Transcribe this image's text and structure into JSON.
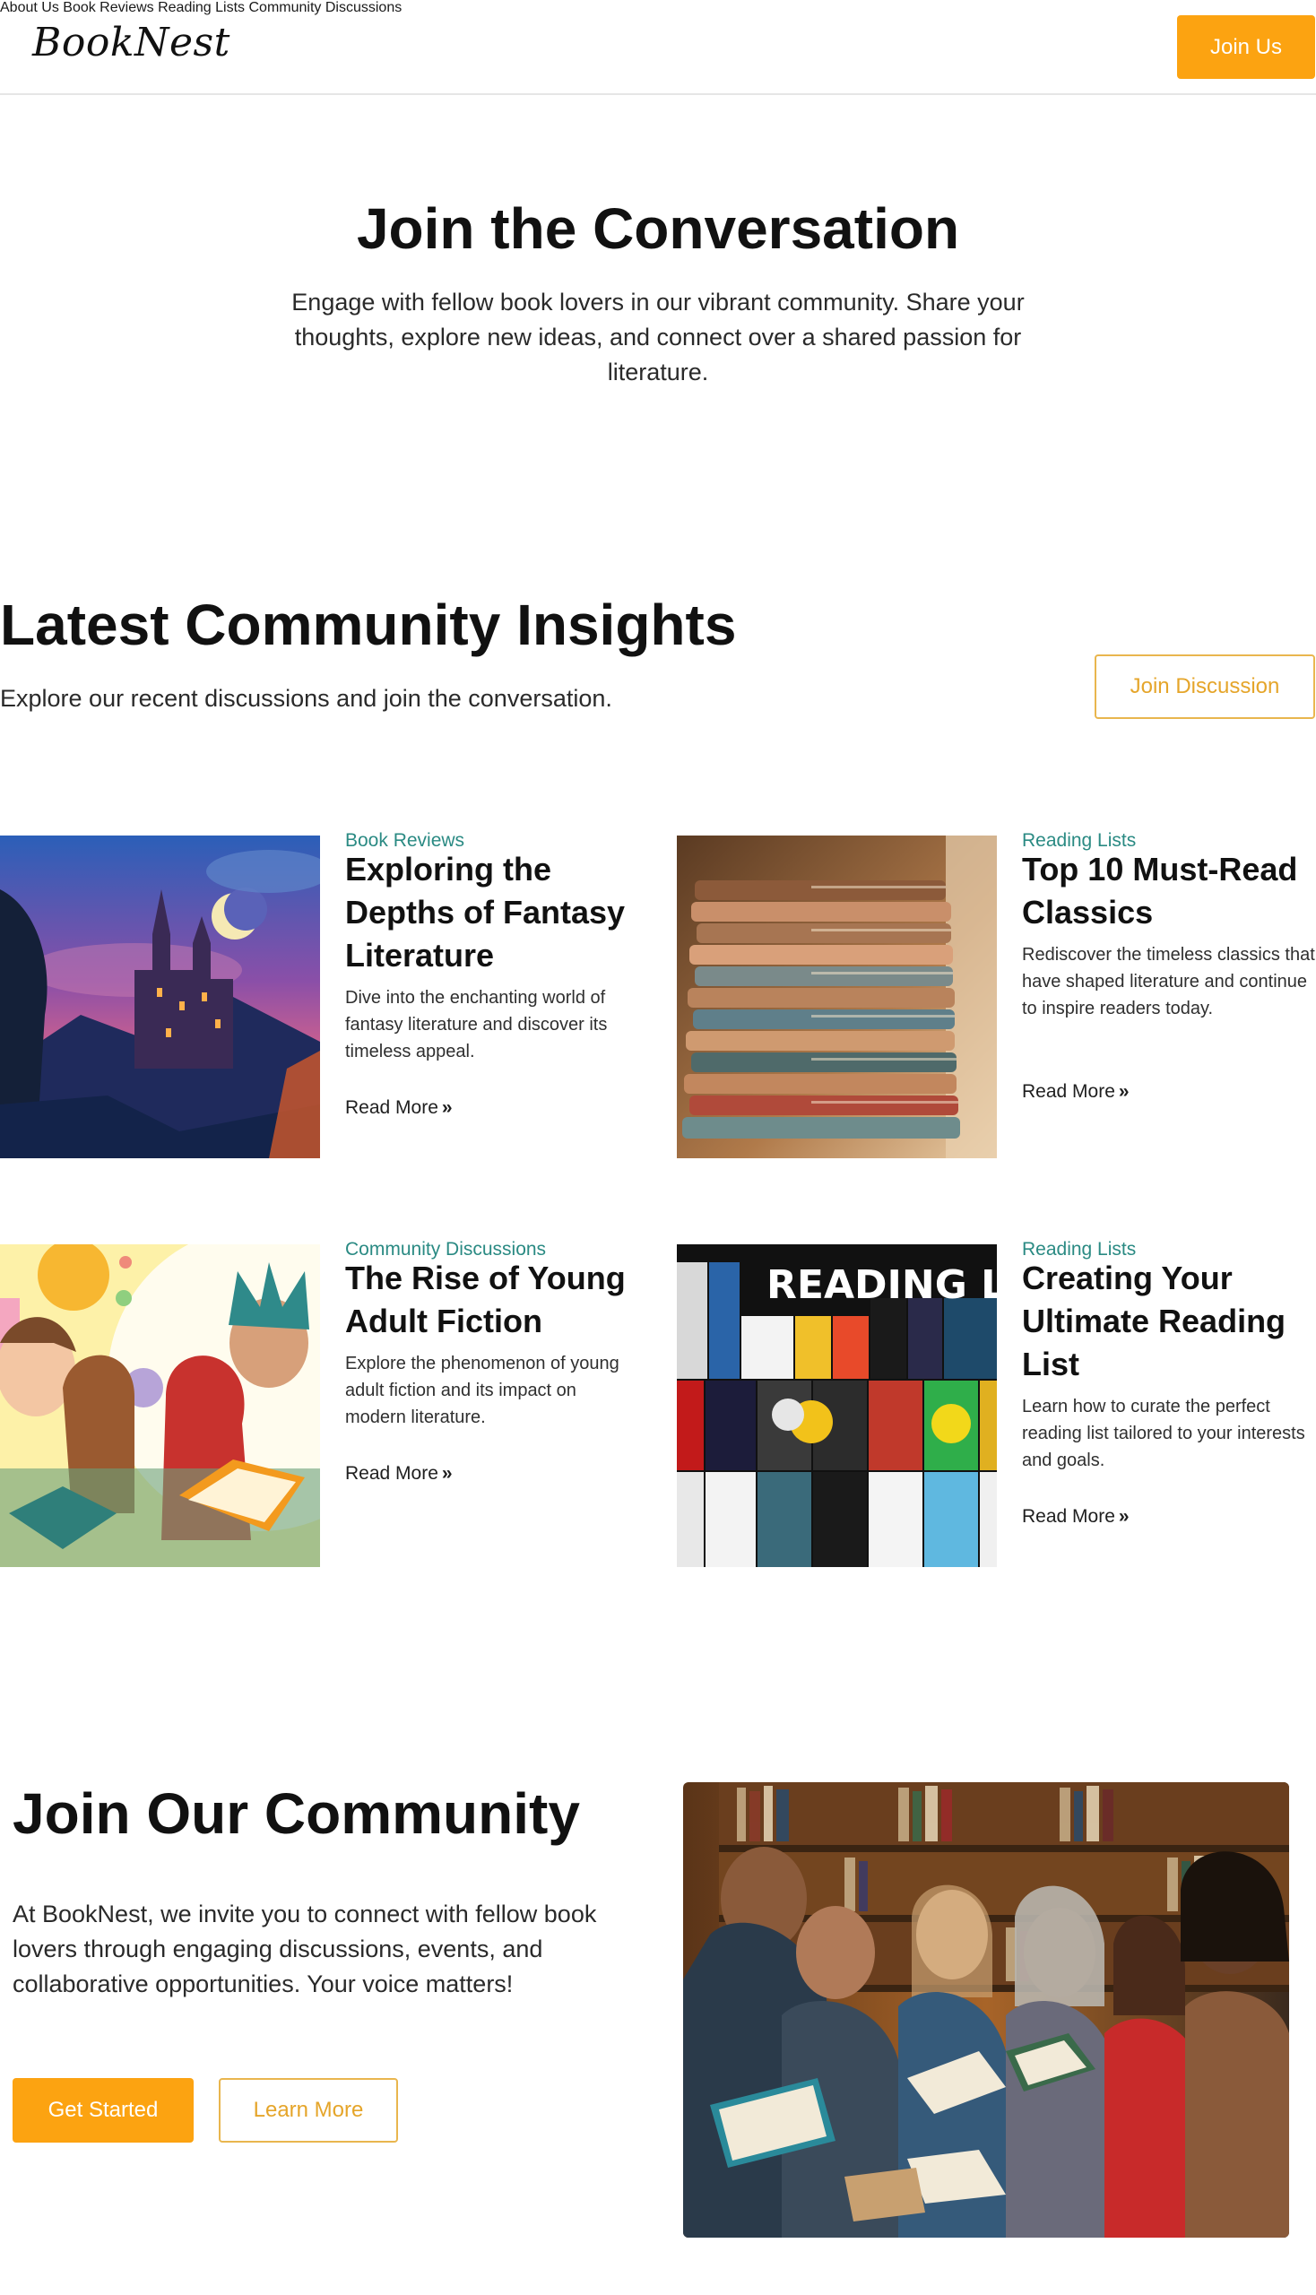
{
  "header": {
    "logo": "BookNest",
    "nav": [
      "About Us",
      "Book Reviews",
      "Reading Lists",
      "Community Discussions"
    ],
    "join_label": "Join Us"
  },
  "hero": {
    "title": "Join the Conversation",
    "description": "Engage with fellow book lovers in our vibrant community. Share your thoughts, explore new ideas, and connect over a shared passion for literature."
  },
  "insights": {
    "title": "Latest Community Insights",
    "subtitle": "Explore our recent discussions and join the conversation.",
    "button_label": "Join Discussion",
    "cards": [
      {
        "category": "Book Reviews",
        "title": "Exploring the Depths of Fantasy Literature",
        "description": "Dive into the enchanting world of fantasy literature and discover its timeless appeal.",
        "link": "Read More",
        "image_icon": "fantasy-castle-image"
      },
      {
        "category": "Reading Lists",
        "title": "Top 10 Must-Read Classics",
        "description": "Rediscover the timeless classics that have shaped literature and continue to inspire readers today.",
        "link": "Read More",
        "image_icon": "book-stack-image"
      },
      {
        "category": "Community Discussions",
        "title": "The Rise of Young Adult Fiction",
        "description": "Explore the phenomenon of young adult fiction and its impact on modern literature.",
        "link": "Read More",
        "image_icon": "young-readers-image"
      },
      {
        "category": "Reading Lists",
        "title": "Creating Your Ultimate Reading List",
        "description": "Learn how to curate the perfect reading list tailored to your interests and goals.",
        "link": "Read More",
        "image_icon": "reading-list-collage-image",
        "image_text": "READING LI"
      }
    ]
  },
  "community": {
    "title": "Join Our Community",
    "description": "At BookNest, we invite you to connect with fellow book lovers through engaging discussions, events, and collaborative opportunities. Your voice matters!",
    "primary_label": "Get Started",
    "secondary_label": "Learn More",
    "image_icon": "readers-group-image"
  },
  "colors": {
    "accent": "#fca311",
    "category": "#2a8a83",
    "text": "#111111"
  }
}
